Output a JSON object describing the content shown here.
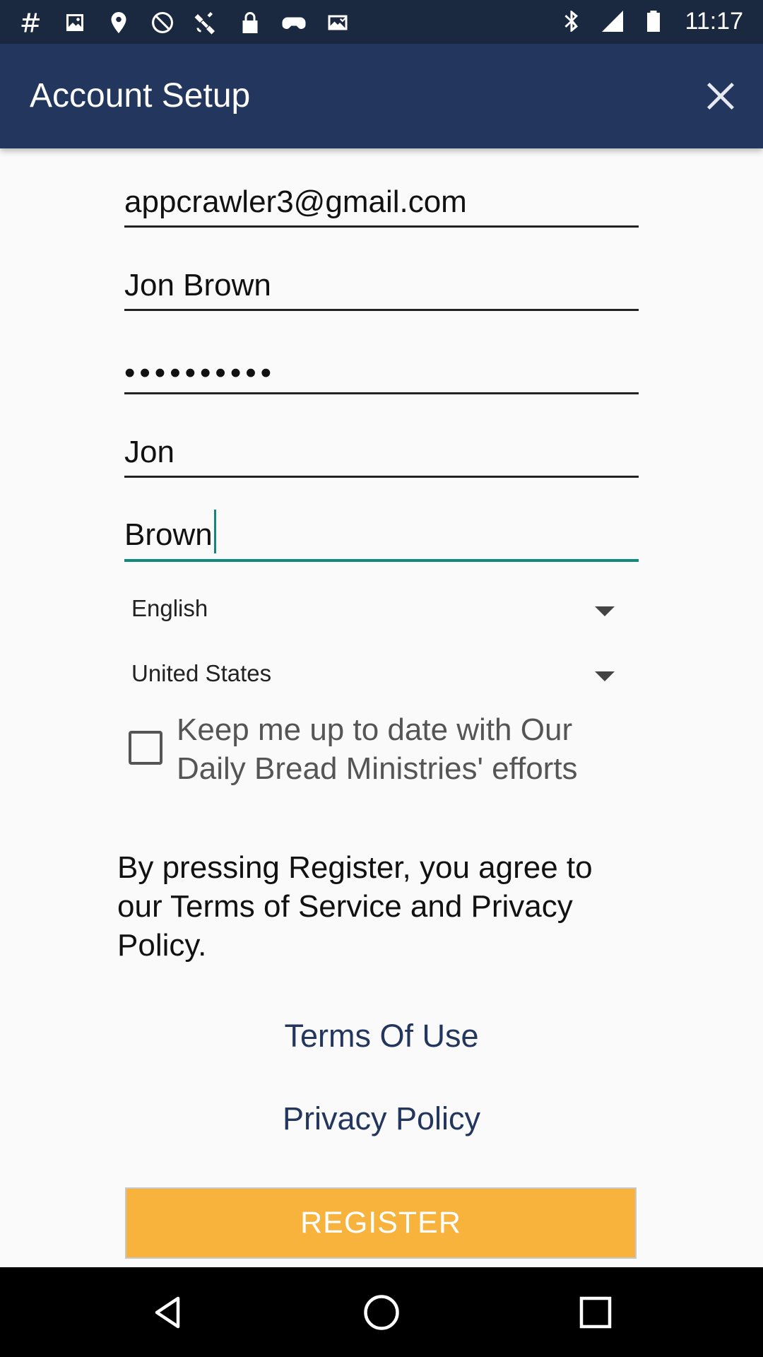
{
  "status_bar": {
    "time": "11:17",
    "left_icons": [
      "hashtag-icon",
      "image-icon",
      "fake-gps-icon",
      "block-icon",
      "satellite-icon",
      "lock-icon",
      "game-icon",
      "photo-check-icon"
    ],
    "right_icons": [
      "bluetooth-icon",
      "signal-icon",
      "battery-icon"
    ]
  },
  "app_bar": {
    "title": "Account Setup",
    "close_icon": "close-icon",
    "background": "#22365e"
  },
  "form": {
    "email": "appcrawler3@gmail.com",
    "display_name": "Jon Brown",
    "password_masked": "••••••••••",
    "first_name": "Jon",
    "last_name": "Brown",
    "language": "English",
    "country": "United States",
    "newsletter_label": "Keep me up to date with Our Daily Bread Ministries' efforts",
    "newsletter_checked": false,
    "focus_color": "#0f8a7a"
  },
  "legal": {
    "agree_text": "By pressing Register, you agree to our Terms of Service and Privacy Policy.",
    "terms_link": "Terms Of Use",
    "privacy_link": "Privacy Policy",
    "link_color": "#22365e"
  },
  "actions": {
    "register_label": "REGISTER",
    "register_color": "#f8b33c"
  },
  "nav_bar": {
    "buttons": [
      "back-icon",
      "home-icon",
      "recents-icon"
    ]
  }
}
